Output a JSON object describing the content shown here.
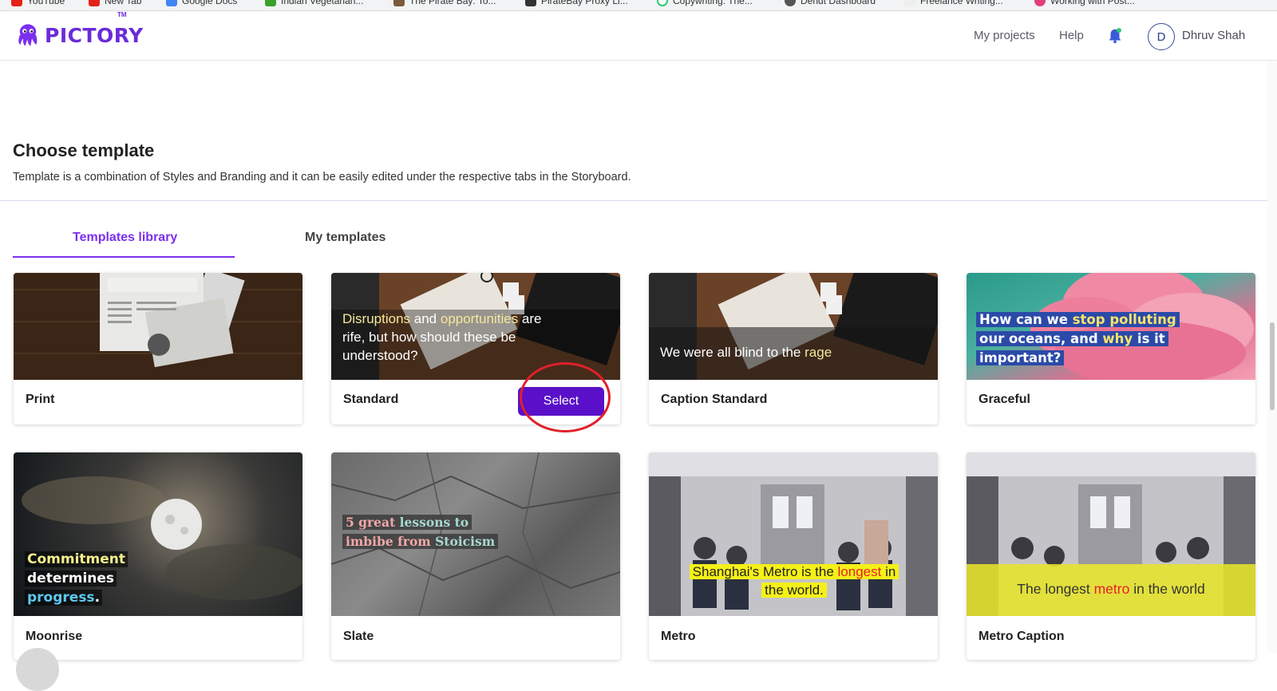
{
  "bookmarks": [
    "YouTube",
    "New Tab",
    "Google Docs",
    "Indian Vegetarian...",
    "The Pirate Bay: To...",
    "PirateBay Proxy Li...",
    "Copywriting: The...",
    "Dendt Dashboard",
    "Freelance Writing...",
    "Working with Post..."
  ],
  "brand": {
    "name": "PICTORY",
    "tm": "TM"
  },
  "nav": {
    "projects": "My projects",
    "help": "Help",
    "avatar_initial": "D",
    "user_name": "Dhruv Shah"
  },
  "page": {
    "title": "Choose template",
    "subtitle": "Template is a combination of Styles and Branding and it can be easily edited under the respective tabs in the Storyboard."
  },
  "tabs": [
    {
      "label": "Templates library",
      "active": true
    },
    {
      "label": "My templates",
      "active": false
    }
  ],
  "templates": [
    {
      "name": "Print"
    },
    {
      "name": "Standard",
      "button": "Select",
      "overlay_a": "Disruptions",
      "overlay_b": " and ",
      "overlay_c": "opportunities",
      "overlay_d": " are",
      "overlay_e": "rife, but how should these be",
      "overlay_f": "understood?"
    },
    {
      "name": "Caption Standard",
      "overlay_a": "We were all blind to the ",
      "overlay_b": "rage"
    },
    {
      "name": "Graceful",
      "overlay_a": "How can we ",
      "overlay_b": "stop polluting",
      "overlay_c": "our oceans, and ",
      "overlay_d": "why",
      "overlay_e": " is it",
      "overlay_f": "important?"
    },
    {
      "name": "Moonrise",
      "overlay_a": "Commitment",
      "overlay_b": "determines",
      "overlay_c": "progress",
      "overlay_d": "."
    },
    {
      "name": "Slate",
      "overlay_a": "5 great ",
      "overlay_b": "lessons to",
      "overlay_c": "imbibe from ",
      "overlay_d": "Stoicism"
    },
    {
      "name": "Metro",
      "overlay_a": "Shanghai's Metro is the ",
      "overlay_b": "longest",
      "overlay_c": " in",
      "overlay_d": "the world."
    },
    {
      "name": "Metro Caption",
      "overlay_a": "The longest ",
      "overlay_b": "metro",
      "overlay_c": " in the world"
    }
  ],
  "colors": {
    "brand": "#6c2bd9",
    "accent": "#7b2ff0",
    "select_button": "#5a10c8",
    "annotation": "#e0202a"
  }
}
